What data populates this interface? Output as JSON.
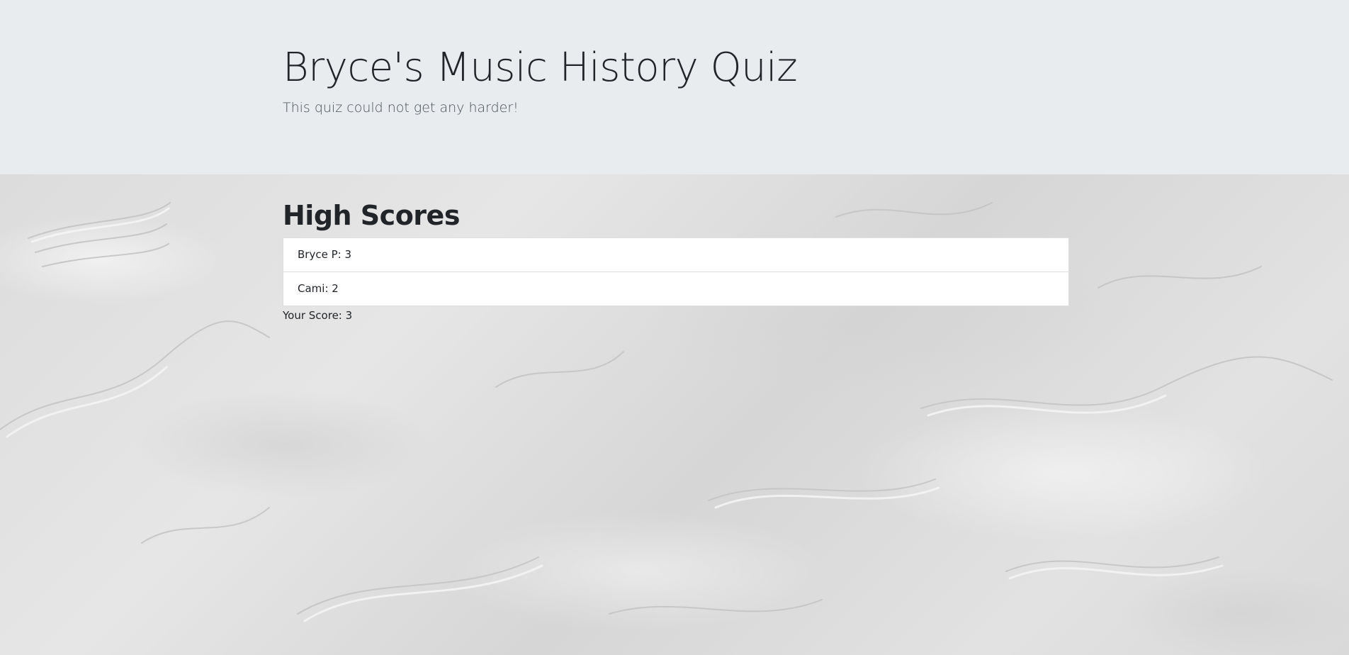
{
  "header": {
    "title": "Bryce's Music History Quiz",
    "subtitle": "This quiz could not get any harder!"
  },
  "high_scores": {
    "heading": "High Scores",
    "entries": [
      "Bryce P: 3",
      "Cami: 2"
    ]
  },
  "your_score": "Your Score: 3",
  "colors": {
    "header_background": "#e9ecef",
    "list_background": "#ffffff",
    "text": "#212529"
  }
}
